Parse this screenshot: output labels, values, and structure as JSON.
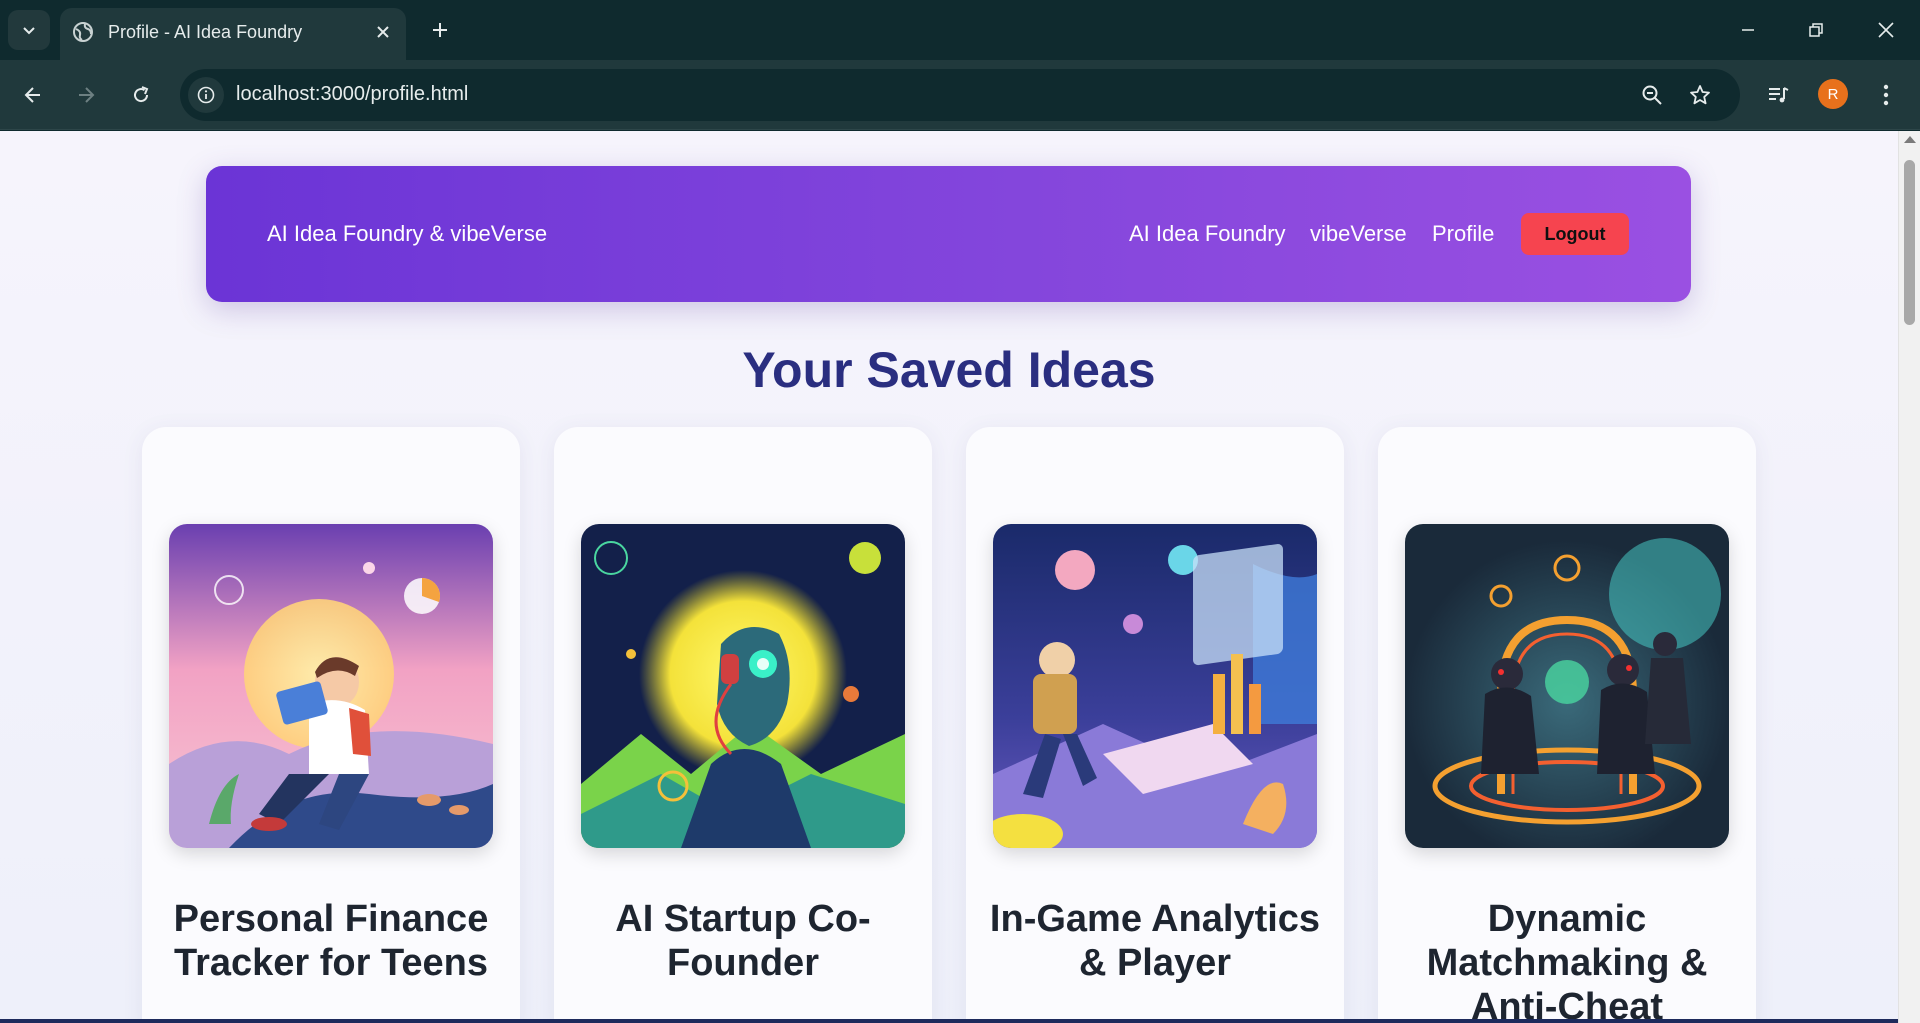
{
  "browser": {
    "tab_title": "Profile - AI Idea Foundry",
    "url": "localhost:3000/profile.html",
    "profile_initial": "R"
  },
  "nav": {
    "brand": "AI Idea Foundry & vibeVerse",
    "links": [
      "AI Idea Foundry",
      "vibeVerse",
      "Profile"
    ],
    "logout_label": "Logout"
  },
  "page": {
    "heading": "Your Saved Ideas"
  },
  "cards": [
    {
      "title": "Personal Finance Tracker for Teens",
      "image": "teen-finance-illustration"
    },
    {
      "title": "AI Startup Co-Founder",
      "image": "ai-robot-illustration"
    },
    {
      "title": "In-Game Analytics & Player",
      "image": "game-analytics-illustration"
    },
    {
      "title": "Dynamic Matchmaking & Anti-Cheat",
      "image": "matchmaking-illustration"
    }
  ],
  "colors": {
    "nav_gradient_start": "#6b34d6",
    "nav_gradient_end": "#9a50e2",
    "logout": "#f6444f",
    "heading": "#2a2e80"
  }
}
